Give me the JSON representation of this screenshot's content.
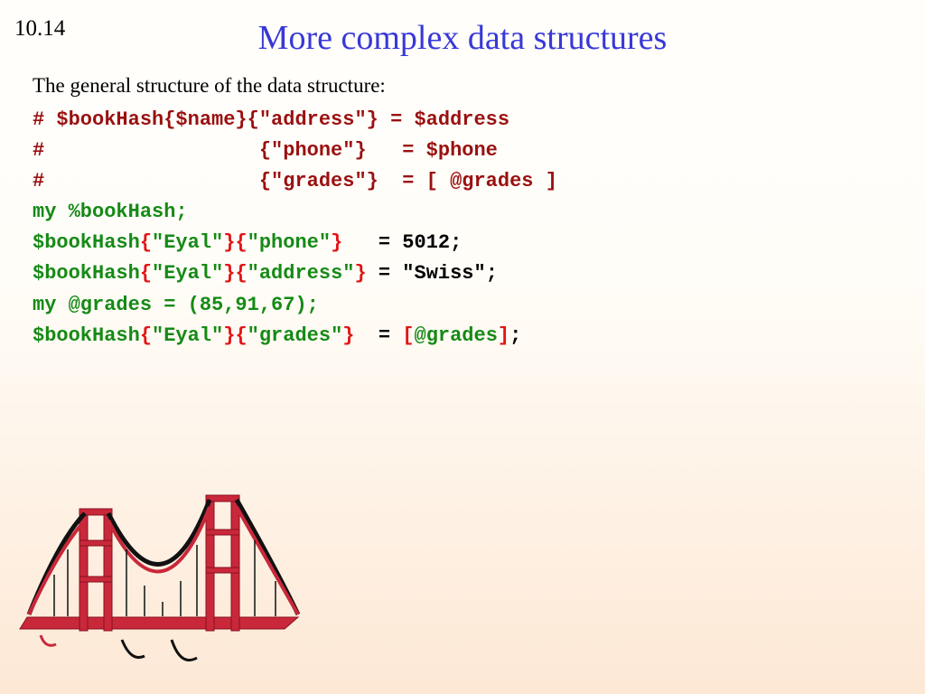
{
  "slideNumber": "10.14",
  "title": "More complex data structures",
  "intro": "The general structure of the data structure:",
  "code": {
    "c1": "# $bookHash{$name}{\"address\"} = $address",
    "c2": "#                  {\"phone\"}   = $phone",
    "c3": "#                  {\"grades\"}  = [ @grades ]",
    "l4a": "my %bookHash;",
    "l5a": "$bookHash",
    "l5b": "{",
    "l5c": "\"Eyal\"",
    "l5d": "}{",
    "l5e": "\"phone\"",
    "l5f": "}",
    "l5g": "   = 5012;",
    "l6a": "$bookHash",
    "l6b": "{",
    "l6c": "\"Eyal\"",
    "l6d": "}{",
    "l6e": "\"address\"",
    "l6f": "}",
    "l6g": " = \"Swiss\";",
    "l7a": "my @grades = (85,91,67);",
    "l8a": "$bookHash",
    "l8b": "{",
    "l8c": "\"Eyal\"",
    "l8d": "}{",
    "l8e": "\"grades\"",
    "l8f": "}",
    "l8g": "  = ",
    "l8h": "[",
    "l8i": "@grades",
    "l8j": "]",
    "l8k": ";"
  }
}
